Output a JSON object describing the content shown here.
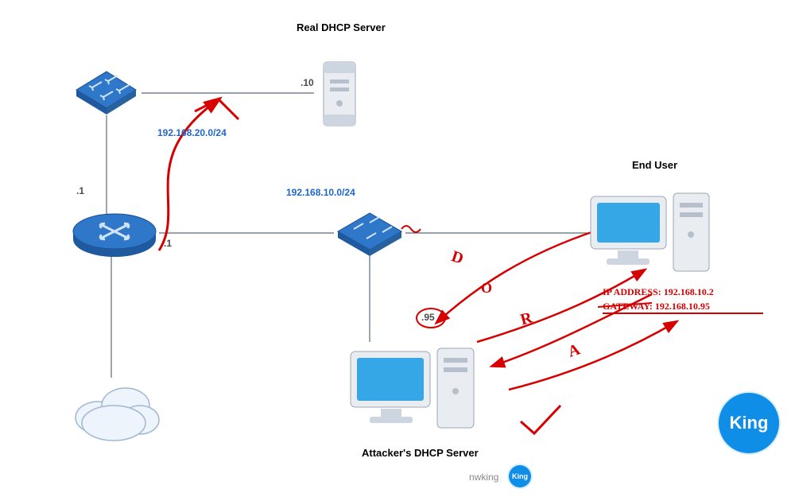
{
  "diagram": {
    "title_real_dhcp": "Real DHCP Server",
    "title_end_user": "End User",
    "title_attacker_dhcp": "Attacker's DHCP Server",
    "subnet_top": "192.168.20.0/24",
    "subnet_mid": "192.168.10.0/24",
    "ip_real_server": ".10",
    "ip_router_top": ".1",
    "ip_router_right": ".1",
    "ip_attacker": ".95",
    "end_user_ip_line1": "IP ADDRESS: 192.168.10.2",
    "end_user_ip_line2": "GATEWAY: 192.168.10.95",
    "dora_D": "D",
    "dora_O": "O",
    "dora_R": "R",
    "dora_A": "A"
  },
  "branding": {
    "footer": "nwking",
    "badge": "King"
  }
}
